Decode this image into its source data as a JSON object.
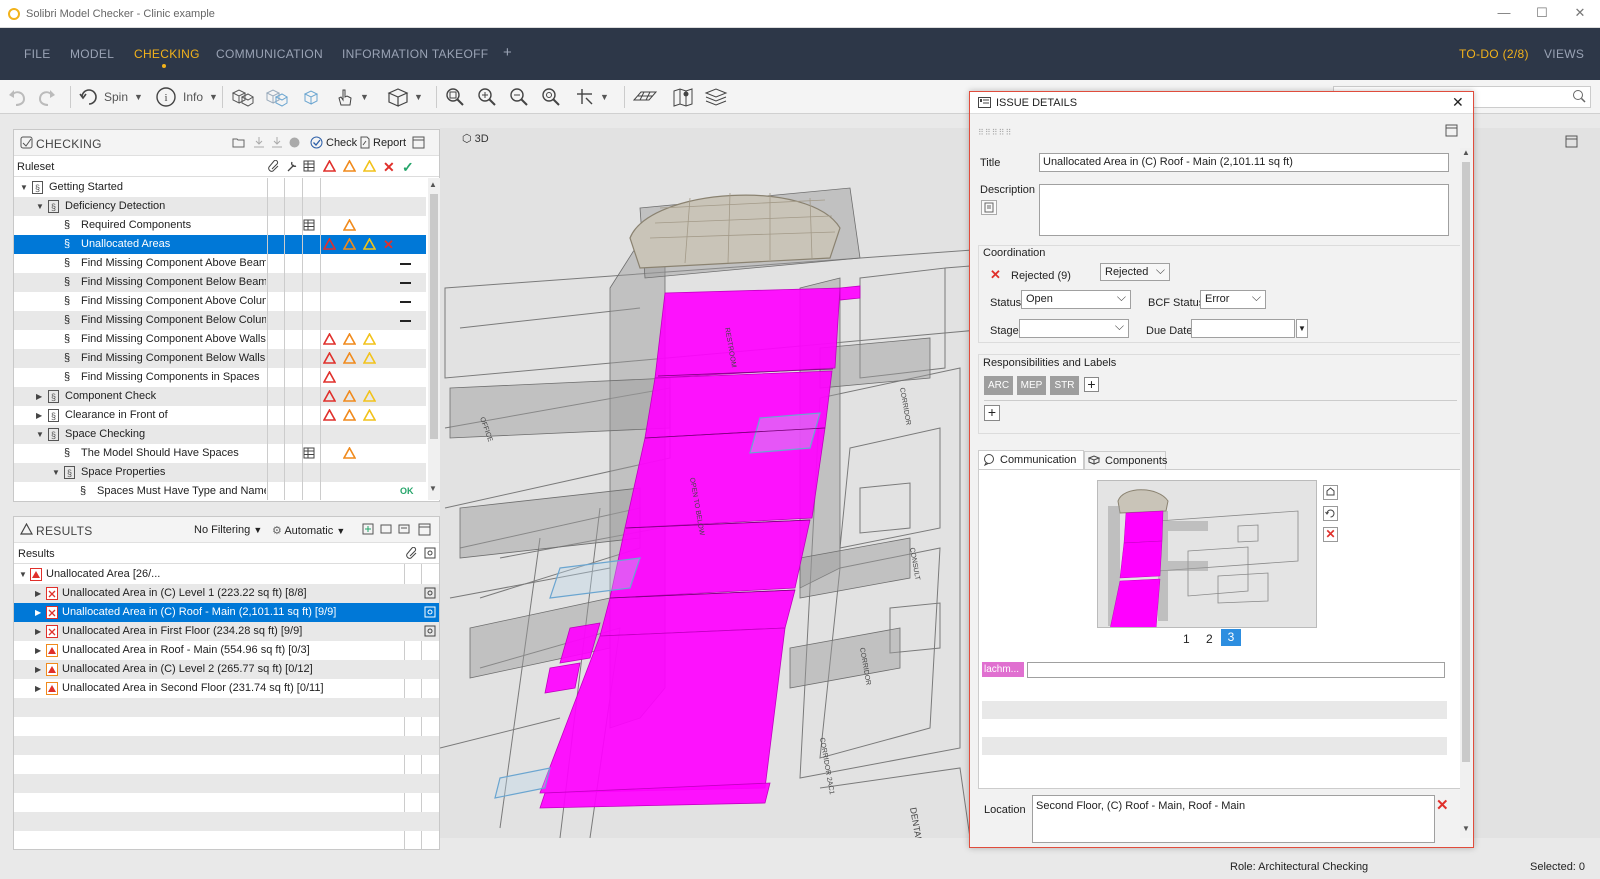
{
  "app": {
    "window_title": "Solibri Model Checker - Clinic example",
    "accent_color": "#f2b21b",
    "menubar_color": "#2d3748"
  },
  "menu": {
    "file": "FILE",
    "model": "MODEL",
    "checking": "CHECKING",
    "communication": "COMMUNICATION",
    "information_takeoff": "INFORMATION TAKEOFF",
    "add": "+",
    "todo": "TO-DO (2/8)",
    "views": "VIEWS"
  },
  "toolbar": {
    "spin_label": "Spin",
    "info_label": "Info"
  },
  "checking_panel": {
    "title": "CHECKING",
    "check_label": "Check",
    "report_label": "Report",
    "ruleset_header": "Ruleset",
    "rows": [
      {
        "label": "Getting Started",
        "level": 0,
        "expand": "▼",
        "kind": "folder",
        "marks": ""
      },
      {
        "label": "Deficiency Detection",
        "level": 1,
        "expand": "▼",
        "kind": "folder",
        "marks": ""
      },
      {
        "label": "Required Components",
        "level": 2,
        "expand": "",
        "kind": "rule",
        "marks": "table,orange"
      },
      {
        "label": "Unallocated Areas",
        "level": 2,
        "expand": "",
        "kind": "rule",
        "marks": "red,orange,yellow,x",
        "selected": true
      },
      {
        "label": "Find Missing Component Above Beams",
        "level": 2,
        "expand": "",
        "kind": "rule",
        "marks": "dash"
      },
      {
        "label": "Find Missing Component Below Beams",
        "level": 2,
        "expand": "",
        "kind": "rule",
        "marks": "dash"
      },
      {
        "label": "Find Missing Component Above Column",
        "level": 2,
        "expand": "",
        "kind": "rule",
        "marks": "dash"
      },
      {
        "label": "Find Missing Component Below Column",
        "level": 2,
        "expand": "",
        "kind": "rule",
        "marks": "dash"
      },
      {
        "label": "Find Missing Component Above Walls",
        "level": 2,
        "expand": "",
        "kind": "rule",
        "marks": "red,orange,yellow"
      },
      {
        "label": "Find Missing Component Below Walls",
        "level": 2,
        "expand": "",
        "kind": "rule",
        "marks": "red,orange,yellow"
      },
      {
        "label": "Find Missing Components in Spaces",
        "level": 2,
        "expand": "",
        "kind": "rule",
        "marks": "red"
      },
      {
        "label": "Component Check",
        "level": 1,
        "expand": "▶",
        "kind": "folder",
        "marks": "red,orange,yellow"
      },
      {
        "label": "Clearance  in Front of",
        "level": 1,
        "expand": "▶",
        "kind": "folder",
        "marks": "red,orange,yellow"
      },
      {
        "label": "Space Checking",
        "level": 1,
        "expand": "▼",
        "kind": "folder",
        "marks": ""
      },
      {
        "label": "The Model Should Have Spaces",
        "level": 2,
        "expand": "",
        "kind": "rule",
        "marks": "table,orange"
      },
      {
        "label": "Space Properties",
        "level": 2,
        "expand": "▼",
        "kind": "folder",
        "marks": ""
      },
      {
        "label": "Spaces Must Have Type and Name",
        "level": 3,
        "expand": "",
        "kind": "rule",
        "marks": "ok"
      }
    ],
    "ok_label": "OK"
  },
  "results_panel": {
    "title": "RESULTS",
    "filter_label": "No Filtering",
    "mode_label": "Automatic",
    "results_header": "Results",
    "rows": [
      {
        "label": "Unallocated Area [26/...",
        "level": 0,
        "expand": "▼",
        "icon": "red-doc"
      },
      {
        "label": "Unallocated Area in (C) Level 1 (223.22 sq ft) [8/8]",
        "level": 1,
        "expand": "▶",
        "icon": "x-box"
      },
      {
        "label": "Unallocated Area in (C) Roof - Main (2,101.11 sq ft) [9/9]",
        "level": 1,
        "expand": "▶",
        "icon": "x-box",
        "selected": true
      },
      {
        "label": "Unallocated Area in First Floor (234.28 sq ft) [9/9]",
        "level": 1,
        "expand": "▶",
        "icon": "x-box"
      },
      {
        "label": "Unallocated Area in Roof - Main (554.96 sq ft) [0/3]",
        "level": 1,
        "expand": "▶",
        "icon": "warn-box"
      },
      {
        "label": "Unallocated Area in (C) Level 2 (265.77 sq ft) [0/12]",
        "level": 1,
        "expand": "▶",
        "icon": "warn-box"
      },
      {
        "label": "Unallocated Area in Second Floor (231.74 sq ft) [0/11]",
        "level": 1,
        "expand": "▶",
        "icon": "warn-box"
      }
    ]
  },
  "viewport": {
    "label": "3D",
    "highlight_color": "#ff00ff"
  },
  "issue": {
    "header": "ISSUE DETAILS",
    "title_label": "Title",
    "title_value": "Unallocated Area in (C) Roof - Main (2,101.11 sq ft)",
    "description_label": "Description",
    "coordination_label": "Coordination",
    "rejected_text": "Rejected (9)",
    "rejected_select": "Rejected",
    "status_label": "Status",
    "status_value": "Open",
    "bcf_status_label": "BCF Status",
    "bcf_status_value": "Error",
    "stage_label": "Stage",
    "due_date_label": "Due Date",
    "responsibilities_label": "Responsibilities and Labels",
    "tags": [
      "ARC",
      "MEP",
      "STR"
    ],
    "tab_communication": "Communication",
    "tab_components": "Components",
    "pages": [
      "1",
      "2",
      "3"
    ],
    "author_chip": "lachm...",
    "location_label": "Location",
    "location_value": "Second Floor, (C) Roof - Main, Roof - Main"
  },
  "statusbar": {
    "role": "Role: Architectural Checking",
    "selected": "Selected: 0"
  }
}
